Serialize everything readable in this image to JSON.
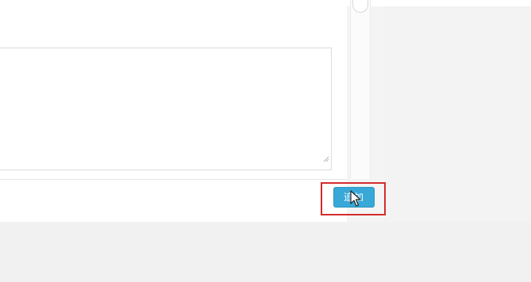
{
  "dialog": {
    "textarea_value": "",
    "submit_label": "追加"
  },
  "colors": {
    "button": "#38a8d8",
    "highlight": "#d42c2c"
  },
  "icons": {
    "resize": "resize-grip-icon",
    "cursor": "mouse-pointer-icon"
  }
}
